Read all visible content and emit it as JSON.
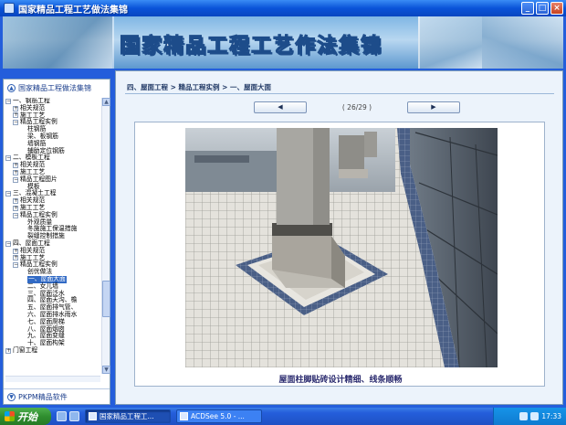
{
  "window": {
    "title": "国家精品工程工艺做法集锦",
    "buttons": [
      "_",
      "□",
      "×"
    ]
  },
  "banner": {
    "title": "国家精品工程工艺作法集锦"
  },
  "sidebar": {
    "header": "国家精品工程做法集锦",
    "footer": "PKPM精品软件",
    "tree": [
      {
        "label": "一、钢筋工程",
        "toggle": "−",
        "indent": 0
      },
      {
        "label": "相关规范",
        "toggle": "+",
        "indent": 1
      },
      {
        "label": "施工工艺",
        "toggle": "+",
        "indent": 1
      },
      {
        "label": "精品工程实例",
        "toggle": "−",
        "indent": 1
      },
      {
        "label": "柱钢筋",
        "toggle": "",
        "indent": 2
      },
      {
        "label": "梁、板钢筋",
        "toggle": "",
        "indent": 2
      },
      {
        "label": "墙钢筋",
        "toggle": "",
        "indent": 2
      },
      {
        "label": "辅助定位钢筋",
        "toggle": "",
        "indent": 2
      },
      {
        "label": "二、模板工程",
        "toggle": "−",
        "indent": 0
      },
      {
        "label": "相关规范",
        "toggle": "+",
        "indent": 1
      },
      {
        "label": "施工工艺",
        "toggle": "+",
        "indent": 1
      },
      {
        "label": "精品工程图片",
        "toggle": "−",
        "indent": 1
      },
      {
        "label": "模板",
        "toggle": "",
        "indent": 2
      },
      {
        "label": "三、混凝土工程",
        "toggle": "−",
        "indent": 0
      },
      {
        "label": "相关规范",
        "toggle": "+",
        "indent": 1
      },
      {
        "label": "施工工艺",
        "toggle": "+",
        "indent": 1
      },
      {
        "label": "精品工程实例",
        "toggle": "−",
        "indent": 1
      },
      {
        "label": "外观质量",
        "toggle": "",
        "indent": 2
      },
      {
        "label": "冬施施工保温措施",
        "toggle": "",
        "indent": 2
      },
      {
        "label": "裂缝控制措施",
        "toggle": "",
        "indent": 2
      },
      {
        "label": "四、屋面工程",
        "toggle": "−",
        "indent": 0
      },
      {
        "label": "相关规范",
        "toggle": "+",
        "indent": 1
      },
      {
        "label": "施工工艺",
        "toggle": "+",
        "indent": 1
      },
      {
        "label": "精品工程实例",
        "toggle": "−",
        "indent": 1
      },
      {
        "label": "创优做法",
        "toggle": "",
        "indent": 2
      },
      {
        "label": "一、屋面大面",
        "toggle": "",
        "indent": 2,
        "selected": true
      },
      {
        "label": "二、女儿墙",
        "toggle": "",
        "indent": 2
      },
      {
        "label": "三、屋面泛水",
        "toggle": "",
        "indent": 2
      },
      {
        "label": "四、屋面天沟、檐",
        "toggle": "",
        "indent": 2
      },
      {
        "label": "五、屋面排气管、",
        "toggle": "",
        "indent": 2
      },
      {
        "label": "六、屋面排水雨水",
        "toggle": "",
        "indent": 2
      },
      {
        "label": "七、屋面爬梯",
        "toggle": "",
        "indent": 2
      },
      {
        "label": "八、屋面烟囱",
        "toggle": "",
        "indent": 2
      },
      {
        "label": "九、屋面变缝",
        "toggle": "",
        "indent": 2
      },
      {
        "label": "十、屋面构架",
        "toggle": "",
        "indent": 2
      },
      {
        "label": "门窗工程",
        "toggle": "+",
        "indent": 0
      }
    ]
  },
  "main": {
    "breadcrumb": "四、屋面工程 > 精品工程实例 > 一、屋面大面",
    "prev_label": "◀",
    "next_label": "▶",
    "page_indicator": "( 26/29 )",
    "caption": "屋面柱脚贴砖设计精细、线条顺畅"
  },
  "taskbar": {
    "start_label": "开始",
    "tasks": [
      "国家精品工程工...",
      "ACDSee 5.0 - ..."
    ],
    "clock": "17:33"
  }
}
